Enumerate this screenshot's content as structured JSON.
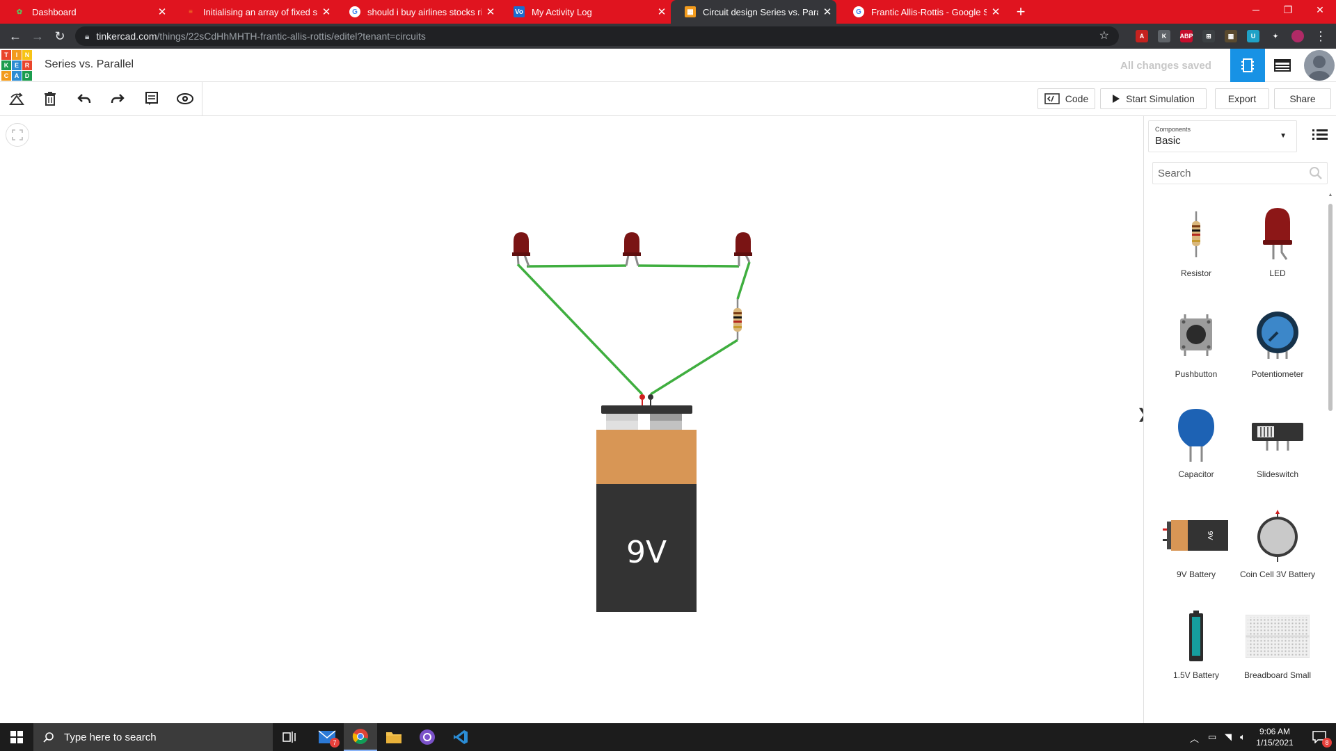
{
  "browser": {
    "tabs": [
      {
        "title": "Dashboard",
        "favicon": "tinkercad-favicon",
        "active": false
      },
      {
        "title": "Initialising an array of fixed size in",
        "favicon": "stack-overflow-favicon",
        "active": false
      },
      {
        "title": "should i buy airlines stocks right",
        "favicon": "google-favicon",
        "active": false
      },
      {
        "title": "My Activity Log",
        "favicon": "voxel-favicon",
        "active": false
      },
      {
        "title": "Circuit design Series vs. Parallel |",
        "favicon": "tinkercad-favicon",
        "active": true
      },
      {
        "title": "Frantic Allis-Rottis - Google Search",
        "favicon": "google-favicon",
        "active": false
      }
    ],
    "url_host": "tinkercad.com",
    "url_path": "/things/22sCdHhMHTH-frantic-allis-rottis/editel?tenant=circuits",
    "extensions": [
      {
        "label": "A",
        "color": "#c5221f",
        "name": "acrobat-icon"
      },
      {
        "label": "K",
        "color": "#5f6368",
        "name": "kami-icon"
      },
      {
        "label": "ABP",
        "color": "#c70d2c",
        "name": "adblock-plus-icon"
      },
      {
        "label": "⊞",
        "color": "#3c4043",
        "name": "grid-extension-icon"
      },
      {
        "label": "▦",
        "color": "#5a4a2f",
        "name": "note-extension-icon"
      },
      {
        "label": "U",
        "color": "#1fa1c6",
        "name": "u-extension-icon"
      },
      {
        "label": "✦",
        "color": "#35363a",
        "name": "puzzle-extensions-icon"
      }
    ]
  },
  "header": {
    "logo_letters": [
      "T",
      "I",
      "N",
      "K",
      "E",
      "R",
      "C",
      "A",
      "D"
    ],
    "logo_colors": [
      "#e9452b",
      "#f29b1d",
      "#f7c315",
      "#1b9c4e",
      "#2d8dd3",
      "#e9452b",
      "#f29b1d",
      "#2d8dd3",
      "#1b9c4e"
    ],
    "design_title": "Series vs. Parallel",
    "save_status": "All changes saved"
  },
  "toolbar": {
    "code_label": "Code",
    "simulate_label": "Start Simulation",
    "export_label": "Export",
    "share_label": "Share"
  },
  "canvas": {
    "battery_label": "9V",
    "led_color": "#7a1414",
    "wire_color": "#3fae3f"
  },
  "panel": {
    "components_label": "Components",
    "components_value": "Basic",
    "search_placeholder": "Search",
    "toggle_glyph": "❯",
    "components": [
      {
        "label": "Resistor",
        "icon": "resistor-icon"
      },
      {
        "label": "LED",
        "icon": "led-icon"
      },
      {
        "label": "Pushbutton",
        "icon": "pushbutton-icon"
      },
      {
        "label": "Potentiometer",
        "icon": "potentiometer-icon"
      },
      {
        "label": "Capacitor",
        "icon": "capacitor-icon"
      },
      {
        "label": "Slideswitch",
        "icon": "slideswitch-icon"
      },
      {
        "label": "9V Battery",
        "icon": "battery-9v-icon"
      },
      {
        "label": "Coin Cell 3V Battery",
        "icon": "coin-cell-icon"
      },
      {
        "label": "1.5V Battery",
        "icon": "battery-1-5v-icon"
      },
      {
        "label": "Breadboard Small",
        "icon": "breadboard-icon"
      }
    ]
  },
  "taskbar": {
    "search_placeholder": "Type here to search",
    "mail_badge": "7",
    "time": "9:06 AM",
    "date": "1/15/2021",
    "notification_badge": "8"
  }
}
